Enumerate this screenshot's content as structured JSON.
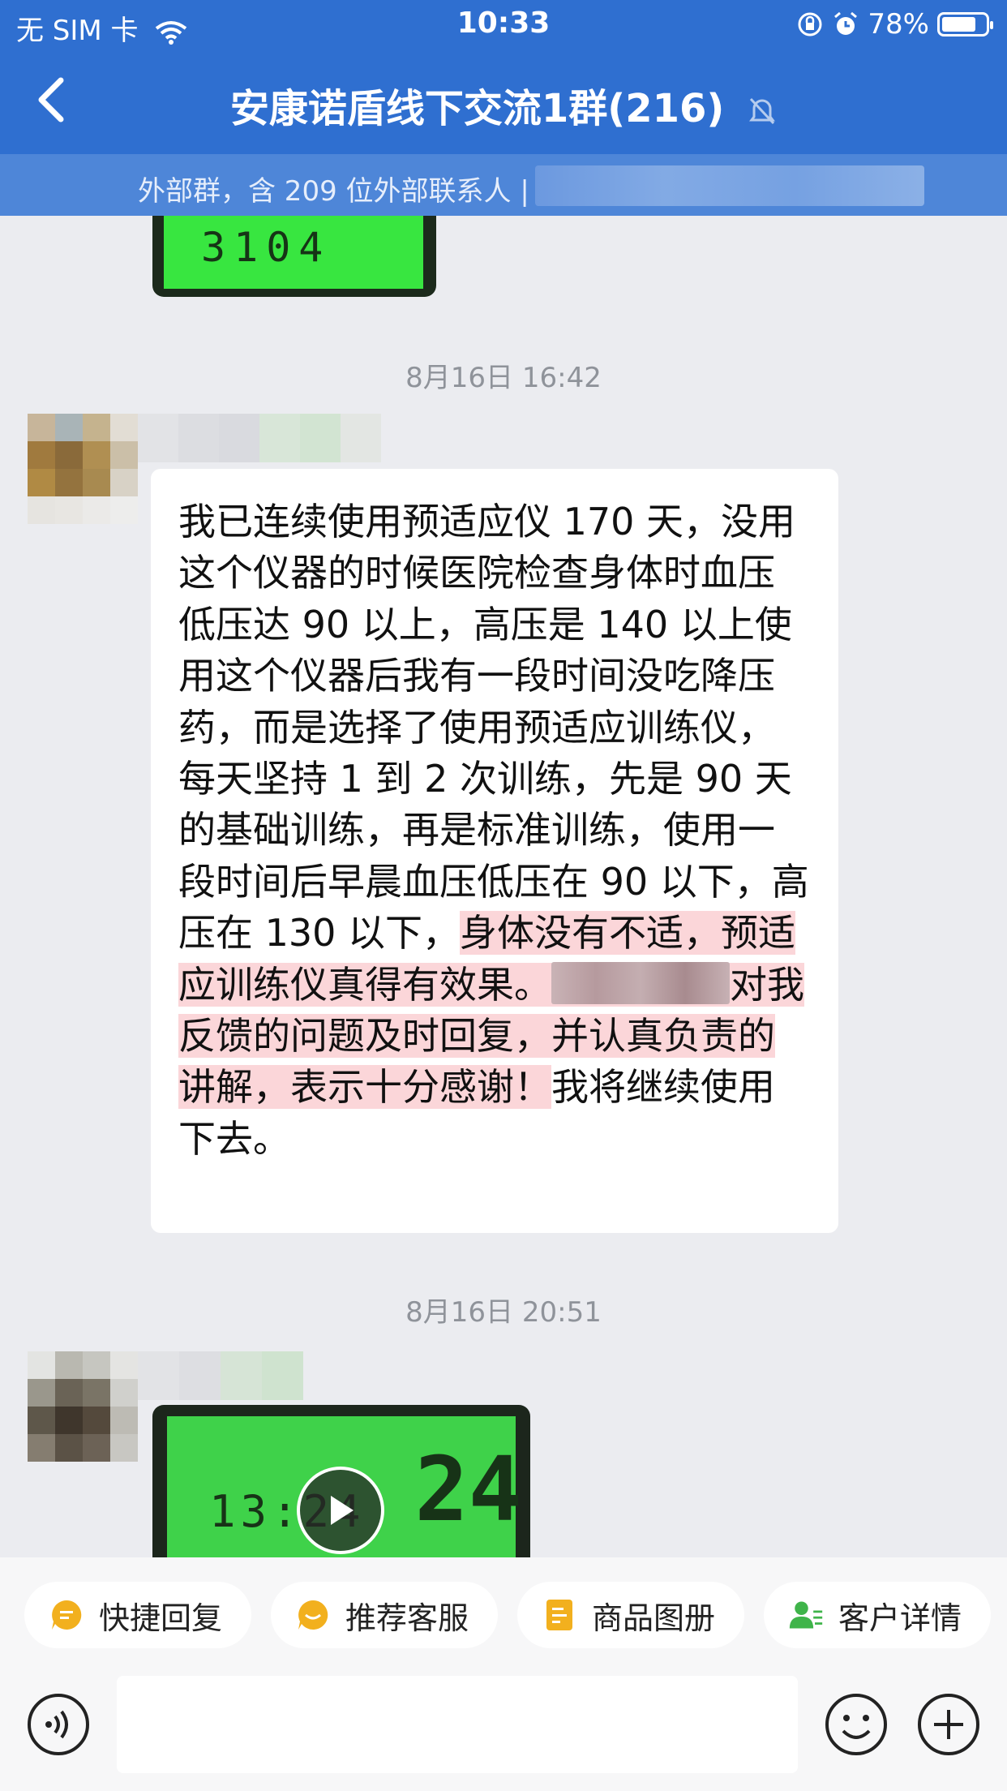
{
  "status_bar": {
    "carrier": "无 SIM 卡",
    "time": "10:33",
    "battery": "78%",
    "battery_level": 0.78
  },
  "header": {
    "title": "安康诺盾线下交流1群(216)",
    "icons": [
      "back-arrow-icon",
      "mute-bell-icon"
    ]
  },
  "subbar": {
    "text": "外部群，含 209 位外部联系人 |"
  },
  "messages": [
    {
      "type": "image",
      "content": "lcd-blood-pressure-photo",
      "digits": "3104"
    },
    {
      "type": "timestamp",
      "text": "8月16日 16:42"
    },
    {
      "type": "text",
      "part1": "我已连续使用预适应仪 170 天，没用这个仪器的时候医院检查身体时血压低压达 90 以上，高压是 140 以上使用这个仪器后我有一段时间没吃降压药，而是选择了使用预适应训练仪，每天坚持 1 到 2 次训练，先是 90 天的基础训练，再是标准训练，使用一段时间后早晨血压低压在 90 以下，高压在 130 以下，",
      "highlight1": "身体没有不适，预适应训练仪真得有效果。",
      "highlight2": "对我反馈的问题及时回复，并认真负责的讲解，表示十分感谢！",
      "part2": "我将继续使用下去。"
    },
    {
      "type": "timestamp",
      "text": "8月16日 20:51"
    },
    {
      "type": "video",
      "content": "lcd-blood-pressure-video",
      "digits": "13:24",
      "big_digits": "24"
    }
  ],
  "quick_actions": [
    {
      "label": "快捷回复",
      "icon": "quick-reply-icon",
      "color": "#f2b01e"
    },
    {
      "label": "推荐客服",
      "icon": "recommend-service-icon",
      "color": "#f2b01e"
    },
    {
      "label": "商品图册",
      "icon": "product-album-icon",
      "color": "#f2b01e"
    },
    {
      "label": "客户详情",
      "icon": "customer-detail-icon",
      "color": "#3fb44a"
    }
  ],
  "input": {
    "placeholder": ""
  },
  "colors": {
    "header": "#2f6fd0",
    "subbar": "#4e86d8",
    "highlight": "#fbd6d9",
    "background": "#ebecf0"
  }
}
